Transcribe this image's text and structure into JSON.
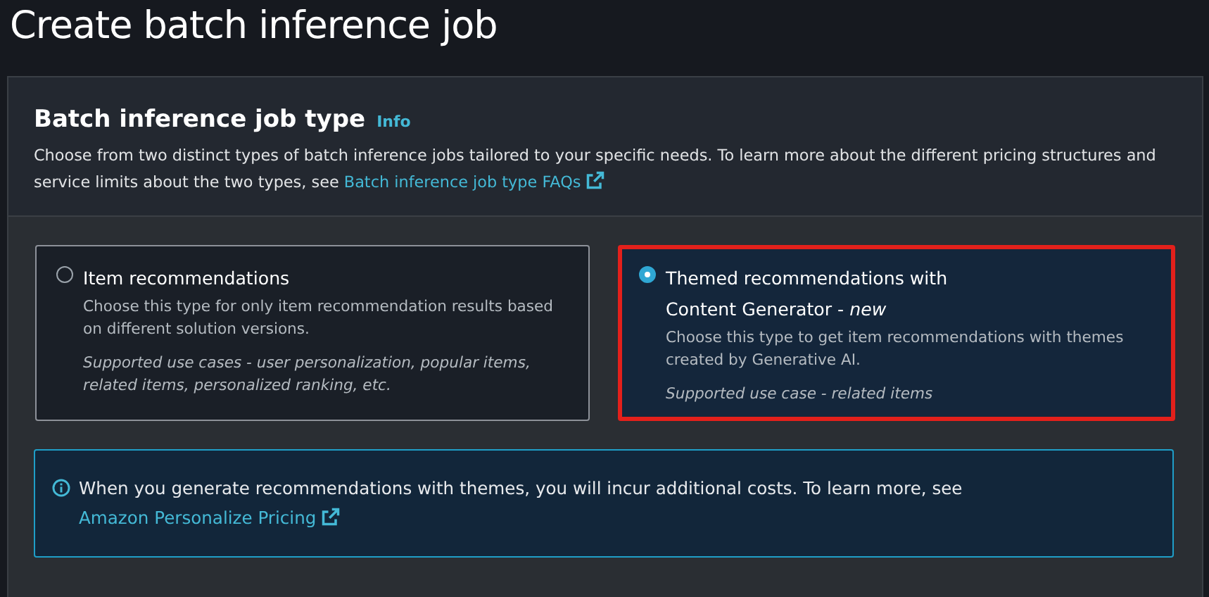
{
  "page": {
    "title": "Create batch inference job"
  },
  "section": {
    "title": "Batch inference job type",
    "info_link": "Info",
    "description": "Choose from two distinct types of batch inference jobs tailored to your specific needs. To learn more about the different pricing structures and service limits about the two types, see ",
    "faq_link": "Batch inference job type FAQs"
  },
  "job_types": [
    {
      "title": "Item recommendations",
      "description": "Choose this type for only item recommendation results based on different solution versions.",
      "use_cases": "Supported use cases - user personalization, popular items, related items, personalized ranking, etc.",
      "selected": false,
      "highlighted": false
    },
    {
      "title": "Themed recommendations with Content Generator - *new*",
      "description": "Choose this type to get item recommendations with themes created by Generative AI.",
      "use_cases": "Supported use case - related items",
      "selected": true,
      "highlighted": true
    }
  ],
  "alert": {
    "text": "When you generate recommendations with themes, you will incur additional costs. To learn more, see ",
    "link": "Amazon Personalize Pricing"
  }
}
